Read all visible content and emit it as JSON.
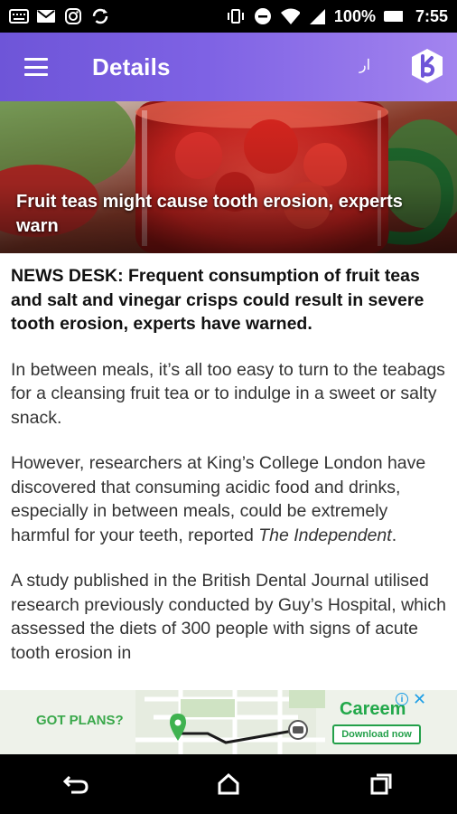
{
  "status_bar": {
    "battery": "100%",
    "time": "7:55",
    "icons": [
      "keyboard-icon",
      "gmail-icon",
      "instagram-icon",
      "sync-icon",
      "vibrate-icon",
      "do-not-disturb-icon",
      "wifi-icon",
      "signal-icon",
      "battery-icon"
    ]
  },
  "app_bar": {
    "title": "Details",
    "lang_label": "ار",
    "colors": {
      "start": "#6e55d8",
      "end": "#a384ef"
    }
  },
  "hero": {
    "headline": "Fruit teas might cause tooth erosion, experts warn"
  },
  "article": {
    "lead": "NEWS DESK: Frequent consumption of fruit teas and salt and vinegar crisps could result in severe tooth erosion, experts have warned.",
    "para1": "In between meals, it’s all too easy to turn to the teabags for a cleansing fruit tea or to indulge in a sweet or salty snack.",
    "para2_text": "However, researchers at King’s College London have discovered that consuming acidic food and drinks, especially in between meals, could be extremely harmful for your teeth, reported ",
    "para2_source": "The Independent",
    "para2_end": ".",
    "para3": "A study published in the British Dental Journal utilised research previously conducted by Guy’s Hospital, which assessed the diets of 300 people with signs of acute tooth erosion in"
  },
  "ad": {
    "headline": "GOT PLANS?",
    "brand": "Careem",
    "cta": "Download now",
    "info": "i",
    "close": "✕"
  },
  "nav": {
    "icons": [
      "back-icon",
      "home-icon",
      "recents-icon"
    ]
  }
}
